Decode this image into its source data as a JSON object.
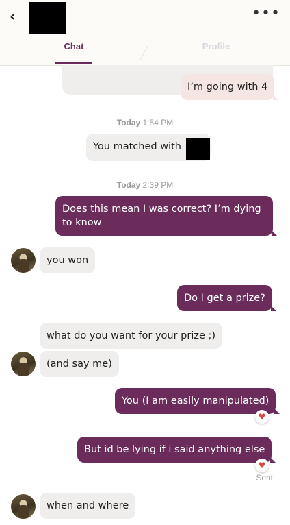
{
  "header": {
    "back_icon": "chevron-left-icon",
    "more_icon": "more-dots-icon",
    "tabs": [
      {
        "label": "Chat",
        "active": true
      },
      {
        "label": "Profile",
        "active": false
      }
    ],
    "accent": "#6b2c5c"
  },
  "messages": [
    {
      "text": "I’m going with 4",
      "from": "me"
    },
    {
      "timestamp_day": "Today",
      "timestamp_time": "1:54 PM"
    },
    {
      "text": "You matched with",
      "from": "system"
    },
    {
      "timestamp_day": "Today",
      "timestamp_time": "2:39 PM"
    },
    {
      "text": "Does this mean I was correct? I’m dying to know",
      "from": "me"
    },
    {
      "text": "you won",
      "from": "them"
    },
    {
      "text": "Do I get a prize?",
      "from": "me"
    },
    {
      "text": "what do you want for your prize ;)",
      "from": "them"
    },
    {
      "text": "(and say me)",
      "from": "them"
    },
    {
      "text": "You (I am easily manipulated)",
      "from": "me",
      "liked": true
    },
    {
      "text": "But id be lying if i said anything else",
      "from": "me",
      "liked": true
    },
    {
      "text": "when and where",
      "from": "them"
    }
  ],
  "status": {
    "sent_label": "Sent"
  },
  "heart_icon": "♥"
}
